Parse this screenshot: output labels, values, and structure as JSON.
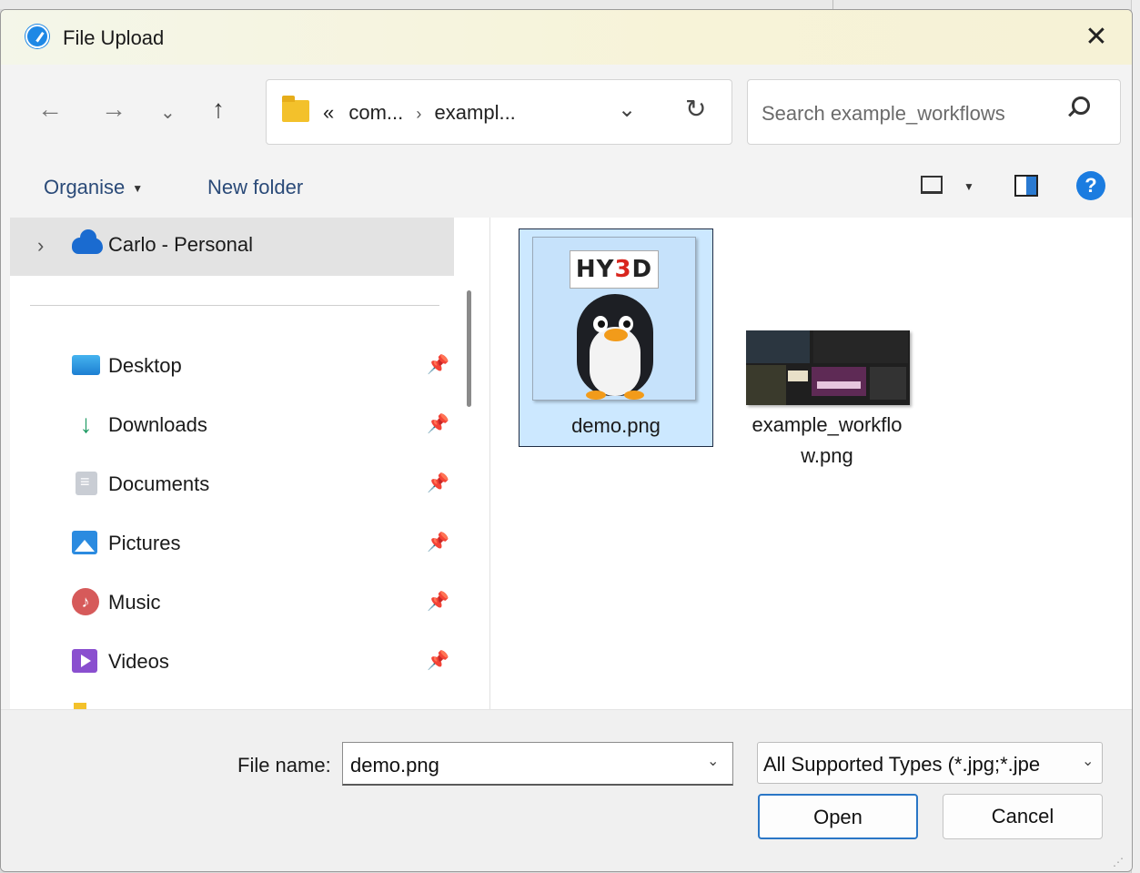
{
  "window": {
    "title": "File Upload",
    "close_glyph": "✕"
  },
  "nav": {
    "back_glyph": "←",
    "forward_glyph": "→",
    "recent_glyph": "⌄",
    "up_glyph": "↑"
  },
  "address": {
    "overflow_glyph": "«",
    "crumbs": [
      "com...",
      "exampl..."
    ],
    "separator_glyph": "›",
    "dropdown_glyph": "⌄",
    "refresh_glyph": "↻"
  },
  "search": {
    "placeholder": "Search example_workflows"
  },
  "toolbar": {
    "organise_label": "Organise",
    "new_folder_label": "New folder",
    "caret_glyph": "▼",
    "help_glyph": "?"
  },
  "sidebar": {
    "top_item": {
      "label": "Carlo - Personal",
      "chevron": "›"
    },
    "pin_glyph": "📌",
    "items": [
      {
        "label": "Desktop",
        "icon": "desktop-icon"
      },
      {
        "label": "Downloads",
        "icon": "download-icon",
        "glyph": "↓"
      },
      {
        "label": "Documents",
        "icon": "documents-icon"
      },
      {
        "label": "Pictures",
        "icon": "pictures-icon"
      },
      {
        "label": "Music",
        "icon": "music-icon",
        "glyph": "♪"
      },
      {
        "label": "Videos",
        "icon": "videos-icon"
      }
    ]
  },
  "files": [
    {
      "name": "demo.png",
      "selected": true,
      "thumb_text": "HY3D"
    },
    {
      "name_line1": "example_workflo",
      "name_line2": "w.png",
      "selected": false
    }
  ],
  "footer": {
    "file_name_label": "File name:",
    "file_name_value": "demo.png",
    "file_type_value": "All Supported Types (*.jpg;*.jpe",
    "chevron_glyph": "⌄",
    "open_label": "Open",
    "cancel_label": "Cancel"
  },
  "colors": {
    "accent": "#2a76c6",
    "selection": "#cce8ff",
    "help": "#1b7ce0",
    "folder": "#f3c12b"
  }
}
